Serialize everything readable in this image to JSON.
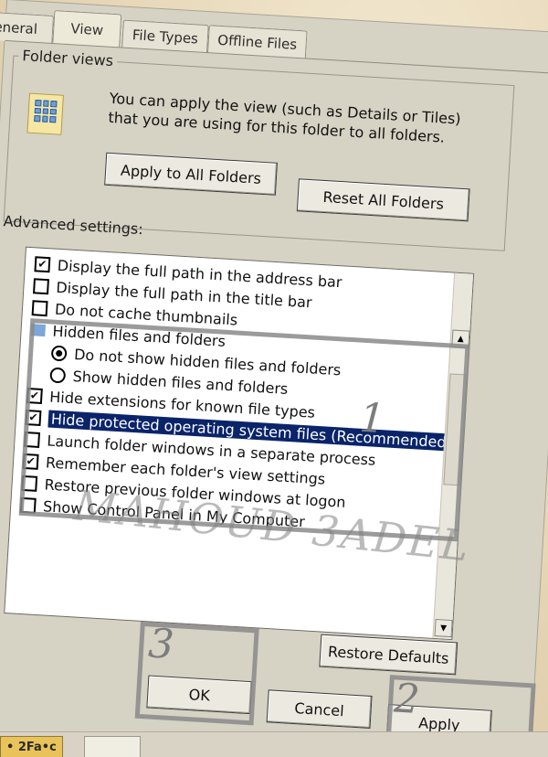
{
  "tabs": [
    {
      "label": "General",
      "visible_text": "eneral"
    },
    {
      "label": "View"
    },
    {
      "label": "File Types"
    },
    {
      "label": "Offline Files"
    }
  ],
  "folder_views": {
    "legend": "Folder views",
    "description": "You can apply the view (such as Details or Tiles) that you are using for this folder to all folders.",
    "apply_button": "Apply to All Folders",
    "reset_button": "Reset All Folders"
  },
  "advanced": {
    "label": "Advanced settings:",
    "items": [
      {
        "text": "Display the full path in the address bar",
        "type": "checkbox",
        "checked": true
      },
      {
        "text": "Display the full path in the title bar",
        "type": "checkbox",
        "checked": false
      },
      {
        "text": "Do not cache thumbnails",
        "type": "checkbox",
        "checked": false
      },
      {
        "text": "Hidden files and folders",
        "type": "folder"
      },
      {
        "text": "Do not show hidden files and folders",
        "type": "radio",
        "checked": true
      },
      {
        "text": "Show hidden files and folders",
        "type": "radio",
        "checked": false
      },
      {
        "text": "Hide extensions for known file types",
        "type": "checkbox",
        "checked": true
      },
      {
        "text": "Hide protected operating system files (Recommended)",
        "type": "checkbox",
        "checked": true,
        "selected": true
      },
      {
        "text": "Launch folder windows in a separate process",
        "type": "checkbox",
        "checked": false
      },
      {
        "text": "Remember each folder's view settings",
        "type": "checkbox",
        "checked": true
      },
      {
        "text": "Restore previous folder windows at logon",
        "type": "checkbox",
        "checked": false
      },
      {
        "text": "Show Control Panel in My Computer",
        "type": "checkbox",
        "checked": false
      }
    ]
  },
  "buttons": {
    "restore_defaults": "Restore Defaults",
    "ok": "OK",
    "cancel": "Cancel",
    "apply": "Apply"
  },
  "annotations": {
    "one": "1",
    "two": "2",
    "three": "3"
  },
  "watermark": "MAHOUD 3ADEL",
  "taskbar": {
    "item_text": "• 2Fa•c"
  },
  "colors": {
    "selection": "#0a246a",
    "dialog_face": "#d6d2c4",
    "annotation": "#8a8a8a"
  }
}
